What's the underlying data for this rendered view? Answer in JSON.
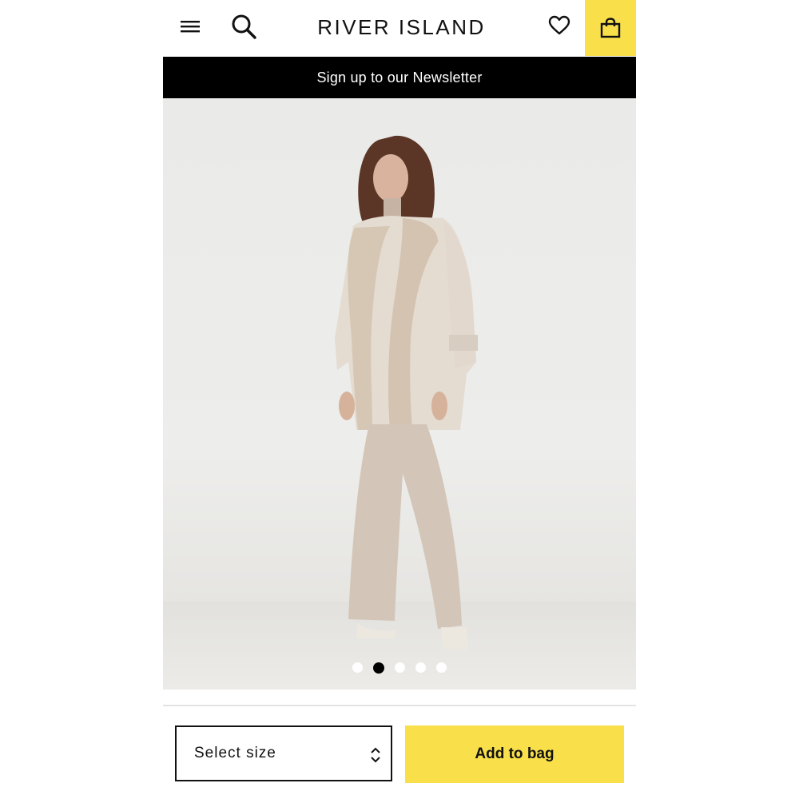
{
  "header": {
    "logo_text": "RIVER ISLAND",
    "icons": {
      "menu": "hamburger-menu-icon",
      "search": "search-icon",
      "wishlist": "heart-icon",
      "bag": "shopping-bag-icon"
    },
    "bag_background": "#f9e04b"
  },
  "newsletter": {
    "text": "Sign up to our Newsletter"
  },
  "gallery": {
    "image_count": 5,
    "active_index": 1
  },
  "actions": {
    "size_select_placeholder": "Select size",
    "add_to_bag_label": "Add to bag",
    "accent_color": "#f9e04b"
  }
}
